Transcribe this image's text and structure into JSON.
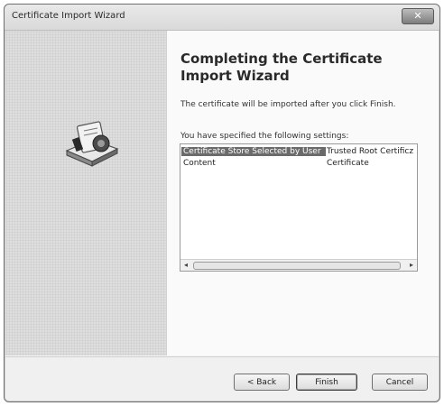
{
  "window": {
    "title": "Certificate Import Wizard",
    "close_label": "✕"
  },
  "main": {
    "heading": "Completing the Certificate Import Wizard",
    "description": "The certificate will be imported after you click Finish.",
    "settings_label": "You have specified the following settings:",
    "settings": [
      {
        "name": "Certificate Store Selected by User",
        "value": "Trusted Root Certificz"
      },
      {
        "name": "Content",
        "value": "Certificate"
      }
    ]
  },
  "buttons": {
    "back": "< Back",
    "finish": "Finish",
    "cancel": "Cancel"
  },
  "icons": {
    "wizard": "certificate-wizard-icon",
    "scroll_left": "◂",
    "scroll_right": "▸"
  }
}
